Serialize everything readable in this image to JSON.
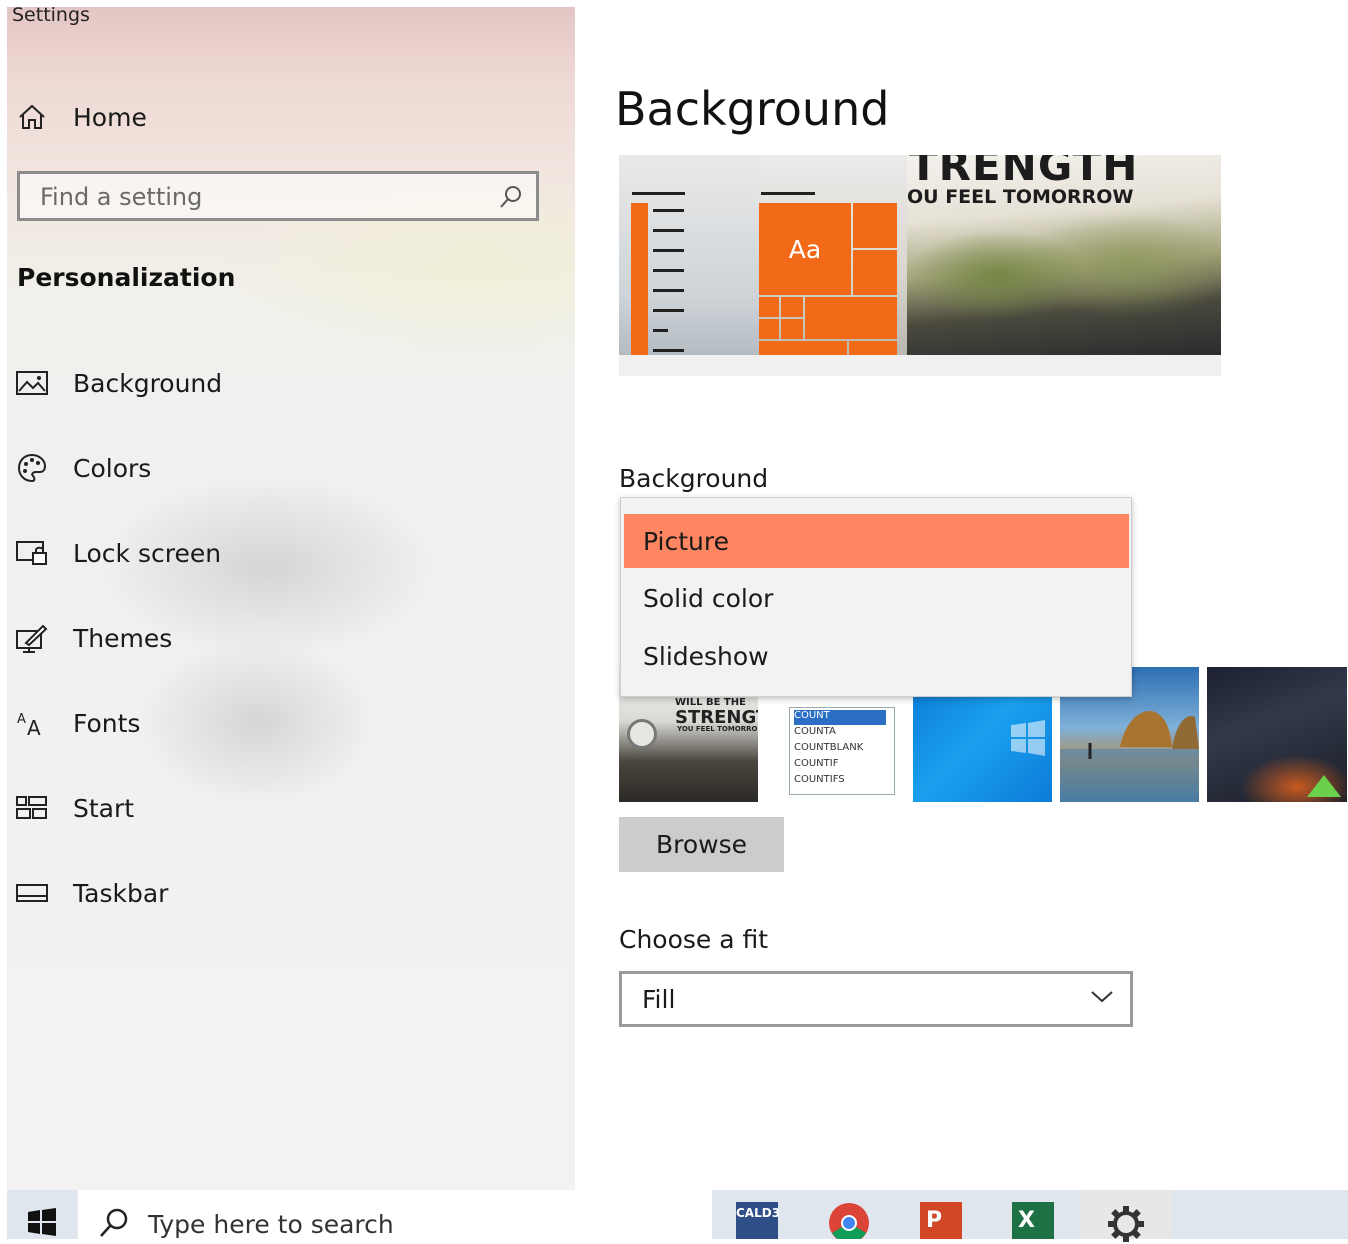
{
  "window": {
    "title": "Settings"
  },
  "sidebar": {
    "home_label": "Home",
    "search_placeholder": "Find a setting",
    "section_heading": "Personalization",
    "items": [
      {
        "label": "Background",
        "icon": "picture-icon"
      },
      {
        "label": "Colors",
        "icon": "palette-icon"
      },
      {
        "label": "Lock screen",
        "icon": "lock-screen-icon"
      },
      {
        "label": "Themes",
        "icon": "themes-brush-icon"
      },
      {
        "label": "Fonts",
        "icon": "fonts-icon"
      },
      {
        "label": "Start",
        "icon": "start-tiles-icon"
      },
      {
        "label": "Taskbar",
        "icon": "taskbar-icon"
      }
    ]
  },
  "main": {
    "title": "Background",
    "preview": {
      "line1": "TRENGTH",
      "line2": "OU FEEL TOMORROW",
      "tile_text": "Aa"
    },
    "background_label": "Background",
    "background_options": [
      "Picture",
      "Solid color",
      "Slideshow"
    ],
    "background_selected": "Picture",
    "recent_pictures": [
      {
        "line1": "WILL BE THE",
        "line2": "STRENGTI",
        "line3": "YOU FEEL TOMORRO"
      },
      {
        "rows": [
          "COUNT",
          "COUNTA",
          "COUNTBLANK",
          "COUNTIF",
          "COUNTIFS"
        ]
      },
      {
        "name": "windows-wallpaper"
      },
      {
        "name": "beach-rocks"
      },
      {
        "name": "night-sky-tent"
      }
    ],
    "browse_label": "Browse",
    "fit_label": "Choose a fit",
    "fit_value": "Fill"
  },
  "taskbar": {
    "search_placeholder": "Type here to search",
    "apps": [
      {
        "name": "CALD3",
        "label": "CALD3"
      },
      {
        "name": "chrome"
      },
      {
        "name": "powerpoint",
        "label": "P"
      },
      {
        "name": "excel",
        "label": "X"
      },
      {
        "name": "settings"
      }
    ]
  },
  "colors": {
    "accent": "#F26A17",
    "selection": "#FF8661",
    "taskbar": "#DFE6ED"
  }
}
